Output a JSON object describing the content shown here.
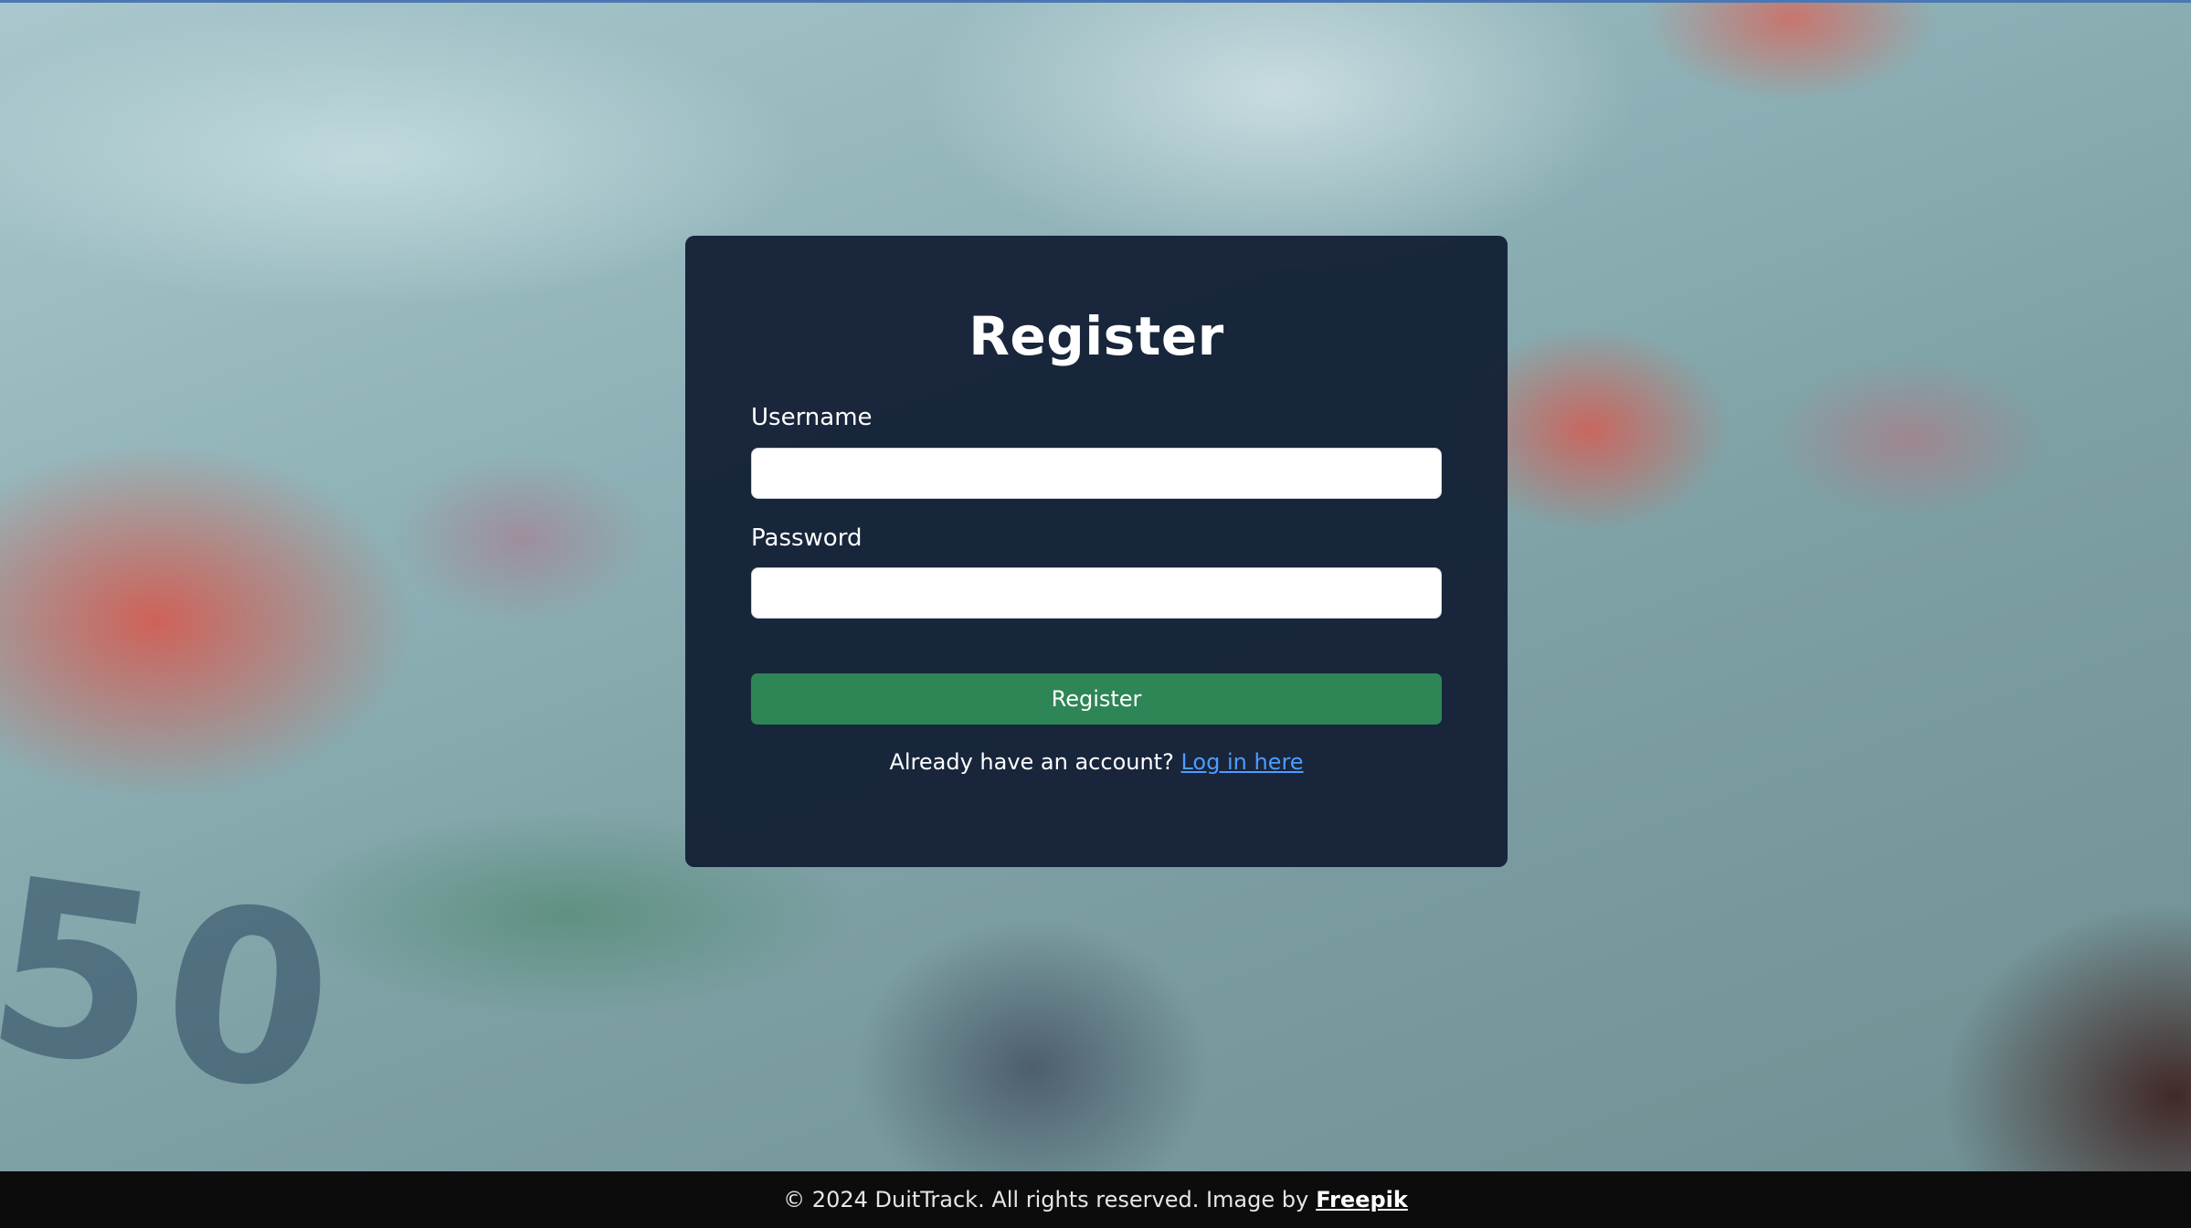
{
  "form": {
    "title": "Register",
    "username_label": "Username",
    "username_value": "",
    "password_label": "Password",
    "password_value": "",
    "submit_label": "Register",
    "login_prompt": "Already have an account?",
    "login_link": "Log in here"
  },
  "footer": {
    "copyright": "© 2024 DuitTrack. All rights reserved. Image by",
    "credit_link": "Freepik"
  },
  "background": {
    "numeral": "50"
  },
  "colors": {
    "card_bg": "#14203a",
    "button": "#2e8556",
    "link": "#4d9cff",
    "footer_bg": "#0c0c0c"
  }
}
